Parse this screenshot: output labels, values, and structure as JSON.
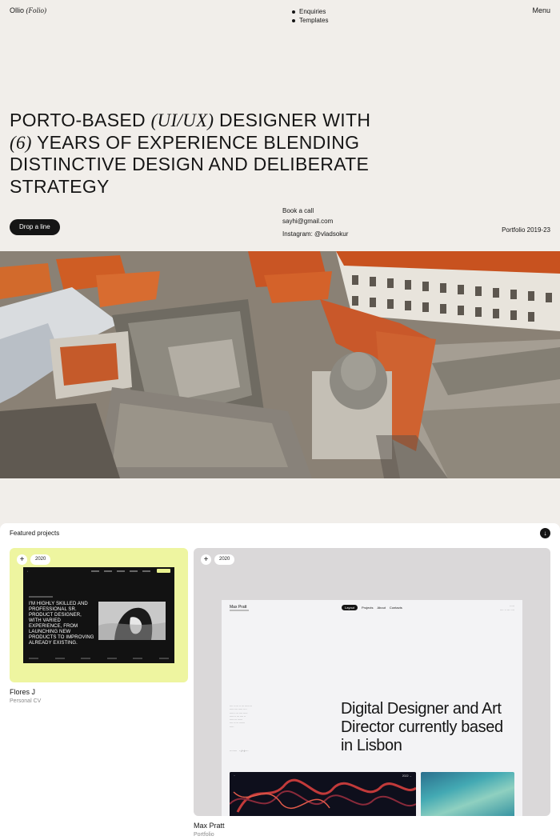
{
  "header": {
    "brand_name": "Ollio",
    "brand_suffix": "(Folio)",
    "nav": [
      "Enquiries",
      "Templates"
    ],
    "menu_label": "Menu"
  },
  "hero": {
    "line1_a": "PORTO-BASED",
    "line1_b": "(UI/UX)",
    "line1_c": "DESIGNER WITH",
    "line2_a": "(6)",
    "line2_b": "YEARS OF EXPERIENCE BLENDING",
    "line3": "DISTINCTIVE DESIGN AND DELIBERATE",
    "line4": "STRATEGY",
    "cta_label": "Drop a line",
    "contact_1": "Book a call",
    "contact_2": "sayhi@gmail.com",
    "contact_3": "Instagram: @vladsokur",
    "portfolio_years": "Portfolio 2019-23"
  },
  "featured": {
    "label": "Featured projects",
    "arrow_icon": "arrow-down-icon",
    "projects": [
      {
        "year": "2020",
        "title": "Flores J",
        "subtitle": "Personal CV",
        "bg": "#eef5a0",
        "preview_headline": "I'M HIGHLY SKILLED AND PROFESSIONAL SR. PRODUCT DESIGNER, WITH VARIED EXPERIENCE, FROM LAUNCHING NEW PRODUCTS TO IMPROVING ALREADY EXISTING."
      },
      {
        "year": "2020",
        "title": "Max Pratt",
        "subtitle": "Portfolio",
        "bg": "#dad8d9",
        "preview_name": "Max Pratt",
        "preview_tabs": [
          "Layout",
          "Projects",
          "About",
          "Contacts"
        ],
        "preview_headline": "Digital Designer and Art Director currently based in Lisbon",
        "preview_tile_label": "2022 →"
      }
    ]
  },
  "colors": {
    "page_bg": "#f1eeea",
    "ink": "#151515",
    "card1_bg": "#eef5a0",
    "card2_bg": "#dad8d9"
  }
}
